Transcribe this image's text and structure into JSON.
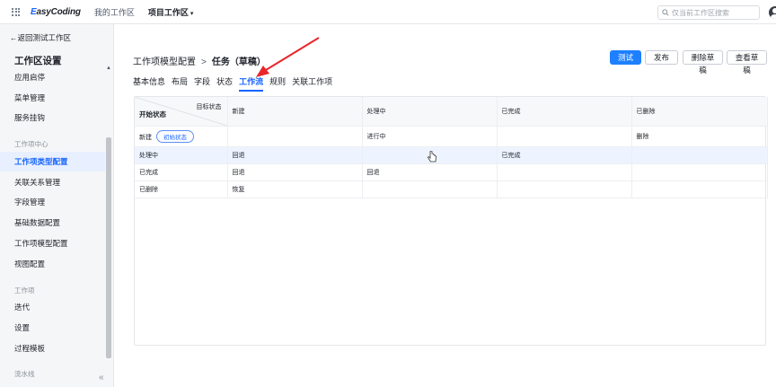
{
  "topbar": {
    "logo_prefix": "E",
    "logo_rest": "asyCoding",
    "nav_my_workspace": "我的工作区",
    "nav_project_workspace": "项目工作区",
    "nav_caret": "▾",
    "search_placeholder": "仅当前工作区搜索"
  },
  "sidebar": {
    "back_label": "←返回测试工作区",
    "title": "工作区设置",
    "items": [
      {
        "label": "应用启停"
      },
      {
        "label": "菜单管理"
      },
      {
        "label": "服务挂钩"
      }
    ],
    "group_workitem_center": "工作项中心",
    "center_items": [
      {
        "label": "工作项类型配置"
      },
      {
        "label": "关联关系管理"
      },
      {
        "label": "字段管理"
      },
      {
        "label": "基础数据配置"
      },
      {
        "label": "工作项模型配置"
      },
      {
        "label": "视图配置"
      }
    ],
    "group_workitem": "工作项",
    "workitem_items": [
      {
        "label": "迭代"
      },
      {
        "label": "设置"
      },
      {
        "label": "过程模板"
      }
    ],
    "group_pipeline": "流水线",
    "collapse_label": "«"
  },
  "main": {
    "breadcrumb_parent": "工作项模型配置",
    "breadcrumb_sep": ">",
    "breadcrumb_current": "任务（草稿）",
    "buttons": {
      "test": "测试",
      "publish": "发布",
      "delete_draft": "删除草稿",
      "view_draft": "查看草稿"
    },
    "tabs": [
      "基本信息",
      "布局",
      "字段",
      "状态",
      "工作流",
      "规则",
      "关联工作项"
    ],
    "active_tab": "工作流"
  },
  "workflow_table": {
    "corner_target": "目标状态",
    "corner_source": "开始状态",
    "columns": [
      "新建",
      "处理中",
      "已完成",
      "已删除"
    ],
    "initial_badge": "初始状态",
    "rows": [
      {
        "state": "新建",
        "cells": [
          "",
          "进行中",
          "",
          "删除"
        ]
      },
      {
        "state": "处理中",
        "cells": [
          "回退",
          "",
          "已完成",
          ""
        ]
      },
      {
        "state": "已完成",
        "cells": [
          "回退",
          "回退",
          "",
          ""
        ]
      },
      {
        "state": "已删除",
        "cells": [
          "恢复",
          "",
          "",
          ""
        ]
      }
    ]
  },
  "colors": {
    "accent": "#1664ff",
    "primary_button": "#1e80ff",
    "annotation_arrow": "#e8262b"
  }
}
